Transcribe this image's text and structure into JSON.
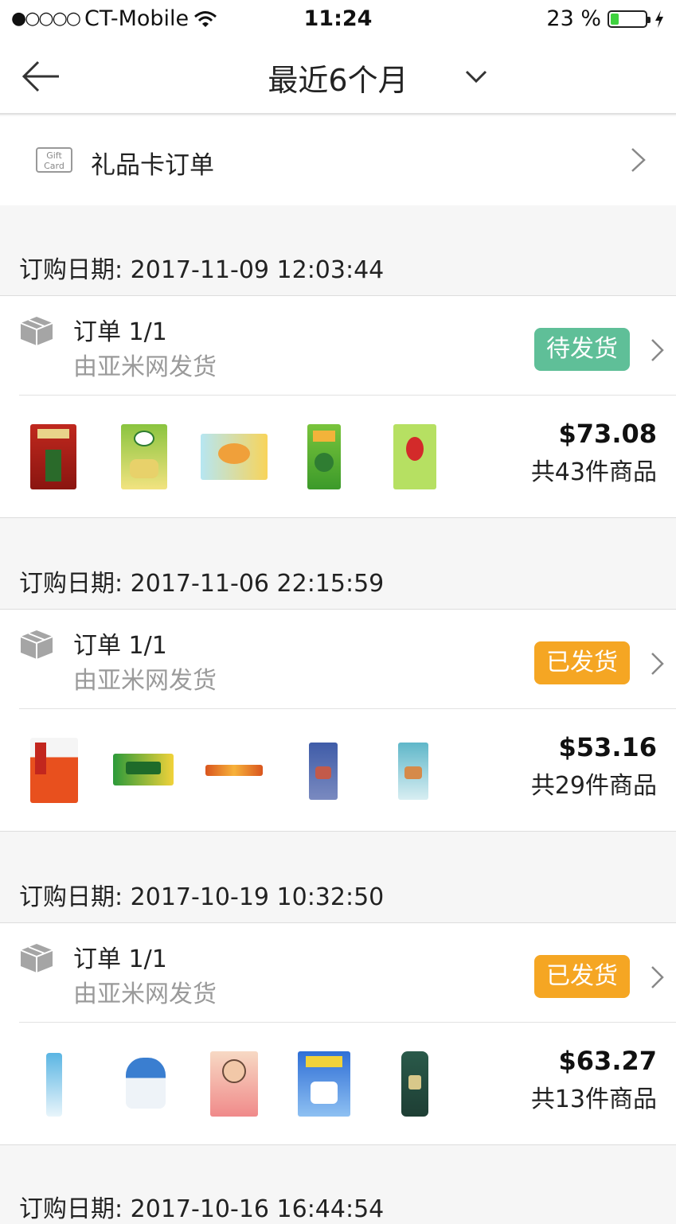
{
  "status_bar": {
    "signal": "●○○○○",
    "carrier": "CT-Mobile",
    "time": "11:24",
    "battery": "23 %",
    "battery_level": 0.23,
    "wifi_icon": "wifi-icon",
    "charging_icon": "charging-bolt-icon"
  },
  "nav": {
    "title": "最近6个月",
    "back_icon": "back-arrow-icon",
    "dropdown_icon": "chevron-down-icon"
  },
  "gift_card": {
    "icon_text": "Gift Card",
    "label": "礼品卡订单"
  },
  "orders": [
    {
      "date": "订购日期: 2017-11-09 12:03:44",
      "order_no": "订单 1/1",
      "shipper": "由亚米网发货",
      "status": "待发货",
      "status_color": "#5fbf98",
      "price": "$73.08",
      "count": "共43件商品"
    },
    {
      "date": "订购日期: 2017-11-06 22:15:59",
      "order_no": "订单 1/1",
      "shipper": "由亚米网发货",
      "status": "已发货",
      "status_color": "#f5a623",
      "price": "$53.16",
      "count": "共29件商品"
    },
    {
      "date": "订购日期: 2017-10-19 10:32:50",
      "order_no": "订单 1/1",
      "shipper": "由亚米网发货",
      "status": "已发货",
      "status_color": "#f5a623",
      "price": "$63.27",
      "count": "共13件商品"
    },
    {
      "date": "订购日期: 2017-10-16 16:44:54"
    }
  ]
}
